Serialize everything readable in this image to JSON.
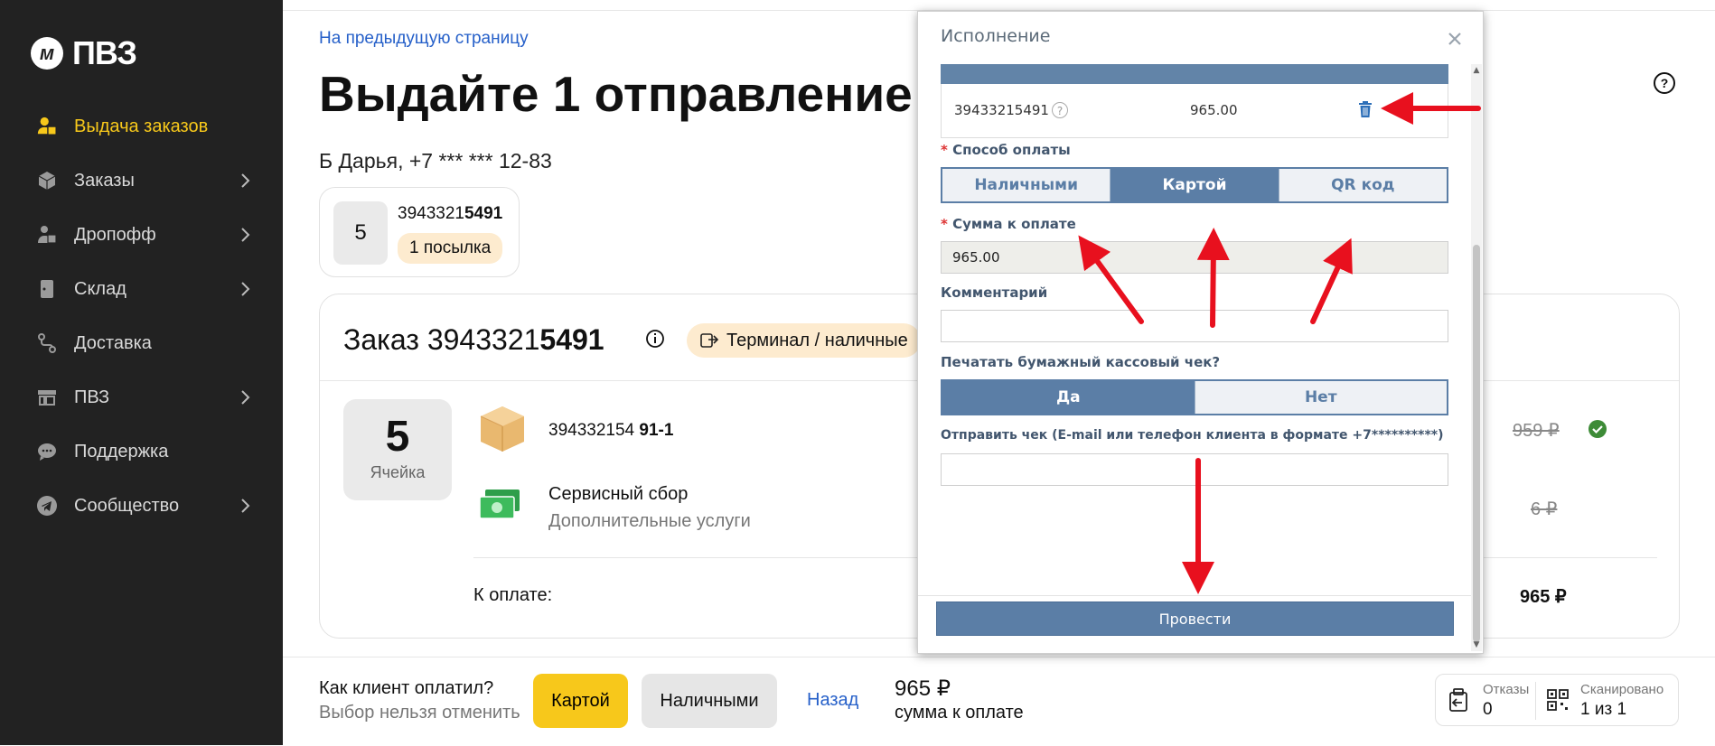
{
  "sidebar": {
    "logo_text": "ПВЗ",
    "logo_mark": "м",
    "items": [
      {
        "label": "Выдача заказов",
        "icon": "user-box-icon",
        "active": true,
        "chevron": false
      },
      {
        "label": "Заказы",
        "icon": "package-icon",
        "chevron": true
      },
      {
        "label": "Дропофф",
        "icon": "dropoff-icon",
        "chevron": true
      },
      {
        "label": "Склад",
        "icon": "warehouse-door-icon",
        "chevron": true
      },
      {
        "label": "Доставка",
        "icon": "route-icon",
        "chevron": false
      },
      {
        "label": "ПВЗ",
        "icon": "store-icon",
        "chevron": true
      },
      {
        "label": "Поддержка",
        "icon": "chat-icon",
        "chevron": false
      },
      {
        "label": "Сообщество",
        "icon": "telegram-icon",
        "chevron": true
      }
    ]
  },
  "main": {
    "back_link": "На предыдущую страницу",
    "title": "Выдайте 1 отправление",
    "client": "Б Дарья, +7 *** *** 12-83",
    "cell_card": {
      "cell": "5",
      "order_prefix": "3943321",
      "order_suffix": "5491",
      "badge": "1 посылка"
    },
    "order": {
      "title_prefix": "Заказ 3943321",
      "title_suffix": "5491",
      "payment_badge": "Терминал / наличные",
      "cell_number": "5",
      "cell_label": "Ячейка",
      "item_code_prefix": "394332154",
      "item_code_suffix": "91-1",
      "item_price": "959 ₽",
      "service_title": "Сервисный сбор",
      "service_subtitle": "Дополнительные услуги",
      "service_price": "6 ₽",
      "total_label": "К оплате:",
      "total_value": "965 ₽"
    }
  },
  "bottom": {
    "question": "Как клиент оплатил?",
    "note": "Выбор нельзя отменить",
    "card_btn": "Картой",
    "cash_btn": "Наличными",
    "back_btn": "Назад",
    "sum_value": "965 ₽",
    "sum_label": "сумма к оплате",
    "refusals_label": "Отказы",
    "refusals_value": "0",
    "scanned_label": "Сканировано",
    "scanned_value": "1 из 1"
  },
  "modal": {
    "title": "Исполнение",
    "row_code": "39433215491",
    "row_help": "?",
    "row_sum": "965.00",
    "payment_method_label": "Способ оплаты",
    "required_mark": "*",
    "methods": [
      "Наличными",
      "Картой",
      "QR код"
    ],
    "selected_method": "Картой",
    "amount_label": "Сумма к оплате",
    "amount_value": "965.00",
    "comment_label": "Комментарий",
    "comment_value": "",
    "print_label": "Печатать бумажный кассовый чек?",
    "print_yes": "Да",
    "print_no": "Нет",
    "send_label": "Отправить чек (E-mail или телефон клиента в формате +7**********)",
    "send_value": "",
    "submit": "Провести"
  },
  "colors": {
    "sidebar_bg": "#222222",
    "accent_yellow": "#f7c81b",
    "link_blue": "#2660c9",
    "modal_blue": "#5b7ea6",
    "annotation_red": "#e8101e",
    "success_green": "#3d8b37"
  }
}
